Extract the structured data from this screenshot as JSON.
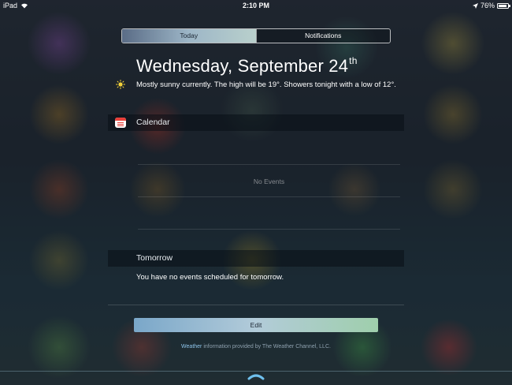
{
  "status_bar": {
    "device": "iPad",
    "time": "2:10 PM",
    "battery": "76%",
    "battery_level": 0.76,
    "icons": [
      "wifi-icon",
      "location-icon",
      "battery-icon"
    ]
  },
  "tabs": [
    {
      "label": "Today",
      "active": true
    },
    {
      "label": "Notifications",
      "active": false
    }
  ],
  "today": {
    "date": "Wednesday, September 24",
    "date_suffix": "th",
    "weather_icon": "sun-icon",
    "weather_summary": "Mostly sunny currently. The high will be 19°. Showers tonight with a low of 12°."
  },
  "calendar": {
    "section_title": "Calendar",
    "icon": "calendar-icon",
    "empty_text": "No Events"
  },
  "tomorrow": {
    "section_title": "Tomorrow",
    "summary": "You have no events scheduled for tomorrow."
  },
  "edit_label": "Edit",
  "credit": {
    "link": "Weather",
    "text": " information provided by The Weather Channel, LLC."
  },
  "colors": {
    "calendar_red": "#e8403a",
    "link_blue": "#8ec4ea"
  }
}
